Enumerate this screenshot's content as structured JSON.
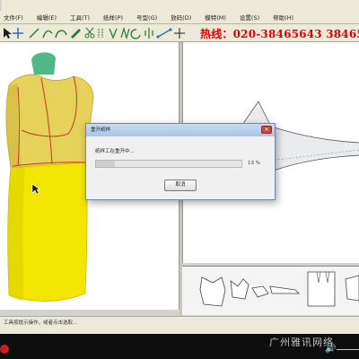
{
  "window": {
    "title": ""
  },
  "menu": [
    "文件(F)",
    "编辑(E)",
    "工具(T)",
    "纸样(P)",
    "号型(G)",
    "放码(D)",
    "模特(M)",
    "设置(S)",
    "帮助(H)"
  ],
  "toolbar": {
    "icons": [
      "select-arrow-icon",
      "move-icon",
      "line-icon",
      "curve-icon",
      "arc-icon",
      "pen-icon",
      "scissors-icon",
      "seam-icon",
      "dart-icon",
      "pleat-icon",
      "rotate-icon",
      "mirror-icon",
      "measure-icon",
      "point-icon"
    ],
    "hotline": "热线：020-38465643  38465"
  },
  "dialog": {
    "title": "重开纸样",
    "message": "纸样工在重开中...",
    "progress_percent": 13,
    "progress_label": "13 %",
    "cancel_label": "取消"
  },
  "statusbar": {
    "text": "工具按提示操作，或者点击选取..."
  },
  "watermark": "广州雅讯网络",
  "colors": {
    "hotline": "#e00000",
    "garment": "#f2e600",
    "pattern_line": "#c0392b"
  }
}
